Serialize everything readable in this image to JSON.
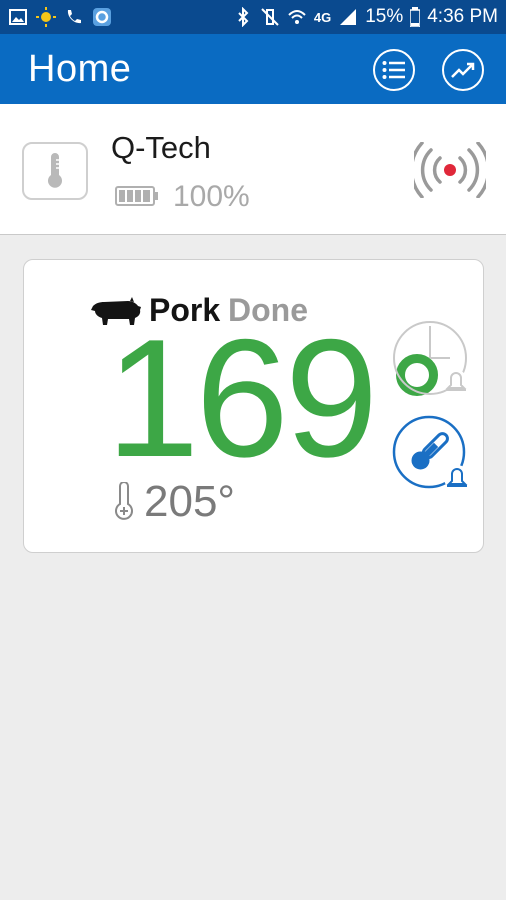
{
  "status_bar": {
    "battery": "15%",
    "time": "4:36 PM",
    "network": "4G"
  },
  "app_bar": {
    "title": "Home"
  },
  "device": {
    "name": "Q-Tech",
    "battery_percent": "100%"
  },
  "probe": {
    "name": "Pork",
    "status": "Done",
    "current_temp": "169",
    "target_temp": "205°"
  },
  "colors": {
    "app_bar": "#0a6bc2",
    "status_bar": "#0a4a8f",
    "temp_green": "#3da746",
    "alarm_blue": "#1a6fc4",
    "signal_red": "#e0283a"
  }
}
